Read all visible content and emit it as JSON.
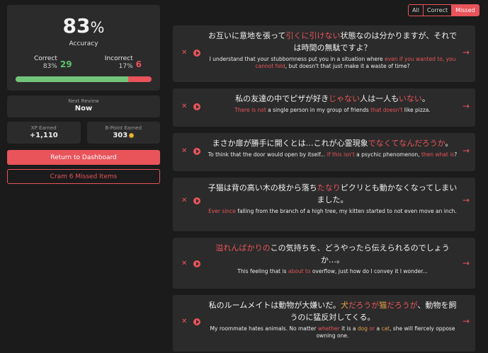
{
  "stats": {
    "percent": "83",
    "percent_symbol": "%",
    "accuracy_label": "Accuracy",
    "correct_label": "Correct",
    "correct_pct": "83%",
    "correct_count": "29",
    "incorrect_label": "Incorrect",
    "incorrect_pct": "17%",
    "incorrect_count": "6",
    "progress_fraction": 0.83
  },
  "next_review": {
    "label": "Next Review",
    "value": "Now"
  },
  "xp": {
    "label": "XP Earned",
    "value": "+1,110"
  },
  "bpoints": {
    "label": "B-Point Earned",
    "value": "303"
  },
  "buttons": {
    "dashboard": "Return to Dashboard",
    "cram": "Cram 6 Missed Items"
  },
  "filters": [
    "All",
    "Correct",
    "Missed"
  ],
  "active_filter": "Missed",
  "items": [
    {
      "jp": [
        [
          "お互いに意地を張って",
          ""
        ],
        [
          "引くに引けない",
          "hl"
        ],
        [
          "状態なのは分かりますが、それでは時間の無駄ですよ？",
          ""
        ]
      ],
      "en": [
        [
          "I understand that your stubbornness put you in a situation where ",
          ""
        ],
        [
          "even if you wanted to, you cannot fold",
          "hl"
        ],
        [
          ", but doesn't that just make it a waste of time?",
          ""
        ]
      ]
    },
    {
      "jp": [
        [
          "私の友達の中でピザが好き",
          ""
        ],
        [
          "じゃない",
          "hl"
        ],
        [
          "人は一人も",
          ""
        ],
        [
          "いない",
          "hl"
        ],
        [
          "。",
          ""
        ]
      ],
      "en": [
        [
          "There is not",
          "hl"
        ],
        [
          " a single person in my group of friends ",
          ""
        ],
        [
          "that doesn't",
          "hl"
        ],
        [
          " like pizza.",
          ""
        ]
      ]
    },
    {
      "jp": [
        [
          "まさか扉が勝手に開くとは…これが心霊現象",
          ""
        ],
        [
          "でなくてなんだろうか",
          "hl"
        ],
        [
          "。",
          ""
        ]
      ],
      "en": [
        [
          "To think that the door would open by itself... ",
          ""
        ],
        [
          "If this isn't",
          "hl"
        ],
        [
          " a psychic phenomenon, ",
          ""
        ],
        [
          "then what is",
          "hl"
        ],
        [
          "?",
          ""
        ]
      ]
    },
    {
      "jp": [
        [
          "子猫は背の高い木の枝から落ち",
          ""
        ],
        [
          "たなり",
          "hl"
        ],
        [
          "ピクリとも動かなくなってしまいました。",
          ""
        ]
      ],
      "en": [
        [
          "Ever since",
          "hl"
        ],
        [
          " falling from the branch of a high tree, my kitten started to not even move an inch.",
          ""
        ]
      ]
    },
    {
      "jp": [
        [
          "溢れんばかりの",
          "hl"
        ],
        [
          "この気持ちを、どうやったら伝えられるのでしょうか…。",
          ""
        ]
      ],
      "en": [
        [
          "This feeling that is ",
          ""
        ],
        [
          "about to",
          "hl"
        ],
        [
          " overflow, just how do I convey it I wonder...",
          ""
        ]
      ]
    },
    {
      "jp": [
        [
          "私のルームメイトは動物が大嫌いだ。",
          ""
        ],
        [
          "犬",
          "org"
        ],
        [
          "だろうが",
          "hl"
        ],
        [
          "猫",
          "org"
        ],
        [
          "だろうが",
          "hl"
        ],
        [
          "、動物を飼うのに猛反対してくる。",
          ""
        ]
      ],
      "en": [
        [
          "My roommate hates animals. No matter ",
          ""
        ],
        [
          "whether",
          "hl"
        ],
        [
          " it is a ",
          ""
        ],
        [
          "dog",
          "org"
        ],
        [
          " ",
          ""
        ],
        [
          "or",
          "hl"
        ],
        [
          " a ",
          ""
        ],
        [
          "cat",
          "org"
        ],
        [
          ", she will fiercely oppose owning one.",
          ""
        ]
      ]
    }
  ]
}
